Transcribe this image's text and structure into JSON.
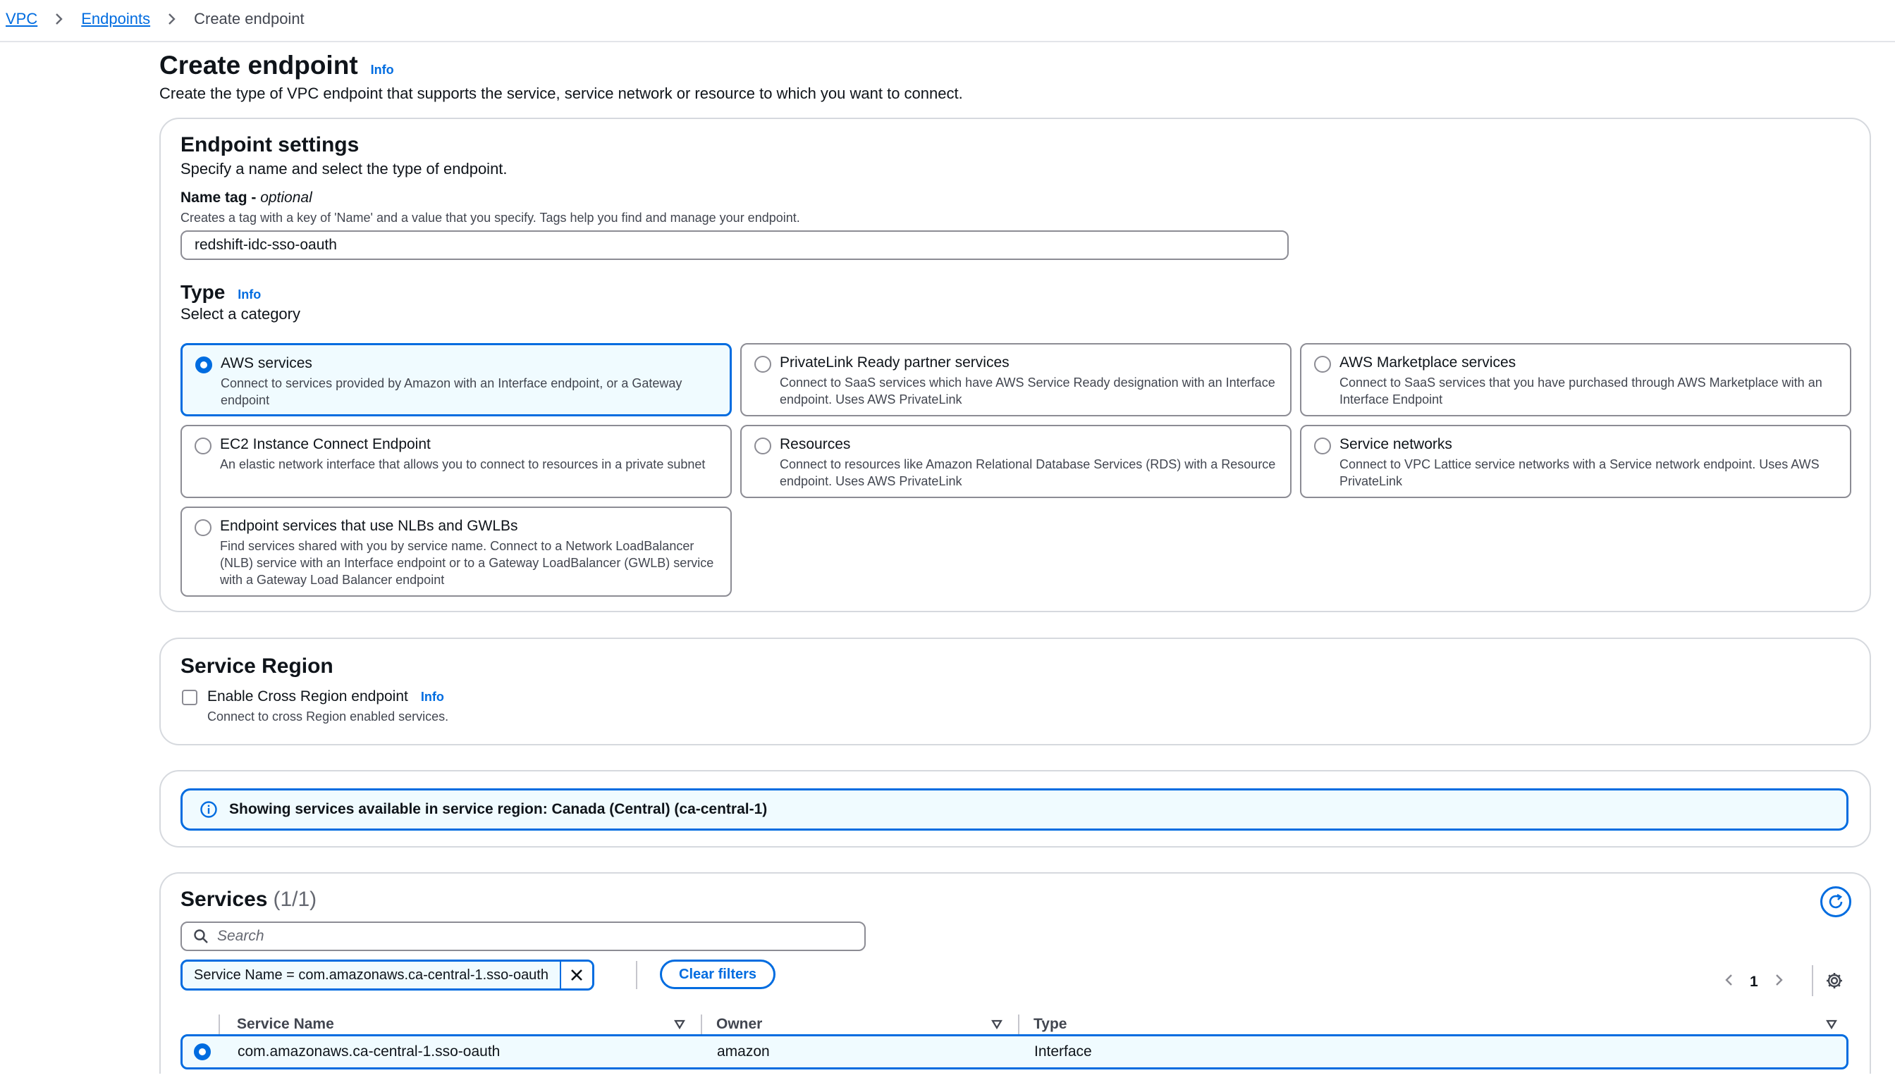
{
  "breadcrumb": {
    "vpc": "VPC",
    "endpoints": "Endpoints",
    "current": "Create endpoint"
  },
  "page": {
    "title": "Create endpoint",
    "info": "Info",
    "description": "Create the type of VPC endpoint that supports the service, service network or resource to which you want to connect."
  },
  "settings": {
    "title": "Endpoint settings",
    "description": "Specify a name and select the type of endpoint.",
    "name_label": "Name tag - ",
    "name_optional": "optional",
    "name_hint": "Creates a tag with a key of 'Name' and a value that you specify. Tags help you find and manage your endpoint.",
    "name_value": "redshift-idc-sso-oauth",
    "type_title": "Type",
    "type_info": "Info",
    "type_sub": "Select a category",
    "tiles": [
      {
        "title": "AWS services",
        "desc": "Connect to services provided by Amazon with an Interface endpoint, or a Gateway endpoint",
        "selected": true
      },
      {
        "title": "PrivateLink Ready partner services",
        "desc": "Connect to SaaS services which have AWS Service Ready designation with an Interface endpoint. Uses AWS PrivateLink",
        "selected": false
      },
      {
        "title": "AWS Marketplace services",
        "desc": "Connect to SaaS services that you have purchased through AWS Marketplace with an Interface Endpoint",
        "selected": false
      },
      {
        "title": "EC2 Instance Connect Endpoint",
        "desc": "An elastic network interface that allows you to connect to resources in a private subnet",
        "selected": false
      },
      {
        "title": "Resources",
        "desc": "Connect to resources like Amazon Relational Database Services (RDS) with a Resource endpoint. Uses AWS PrivateLink",
        "selected": false
      },
      {
        "title": "Service networks",
        "desc": "Connect to VPC Lattice service networks with a Service network endpoint. Uses AWS PrivateLink",
        "selected": false
      },
      {
        "title": "Endpoint services that use NLBs and GWLBs",
        "desc": "Find services shared with you by service name. Connect to a Network LoadBalancer (NLB) service with an Interface endpoint or to a Gateway LoadBalancer (GWLB) service with a Gateway Load Balancer endpoint",
        "selected": false
      }
    ]
  },
  "region": {
    "title": "Service Region",
    "checkbox_label": "Enable Cross Region endpoint",
    "info": "Info",
    "hint": "Connect to cross Region enabled services.",
    "checked": false
  },
  "alert": {
    "text": "Showing services available in service region: Canada (Central) (ca-central-1)"
  },
  "services": {
    "title": "Services",
    "count": "(1/1)",
    "search_placeholder": "Search",
    "filter_token": "Service Name = com.amazonaws.ca-central-1.sso-oauth",
    "clear_filters": "Clear filters",
    "page": "1",
    "columns": [
      "Service Name",
      "Owner",
      "Type"
    ],
    "rows": [
      {
        "service_name": "com.amazonaws.ca-central-1.sso-oauth",
        "owner": "amazon",
        "type": "Interface",
        "selected": true
      }
    ]
  },
  "colors": {
    "accent": "#006ce0",
    "selected_bg": "#f0fbff",
    "border": "#8c8c94"
  }
}
